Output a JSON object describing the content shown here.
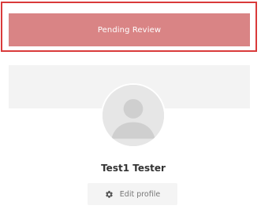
{
  "status": {
    "label": "Pending Review",
    "color": "#d98485"
  },
  "profile": {
    "name": "Test1 Tester",
    "avatar_icon": "user-silhouette-icon",
    "edit_label": "Edit profile",
    "edit_icon": "gear-icon"
  },
  "colors": {
    "highlight_border": "#d93a3a",
    "header_bg": "#f3f3f3"
  }
}
